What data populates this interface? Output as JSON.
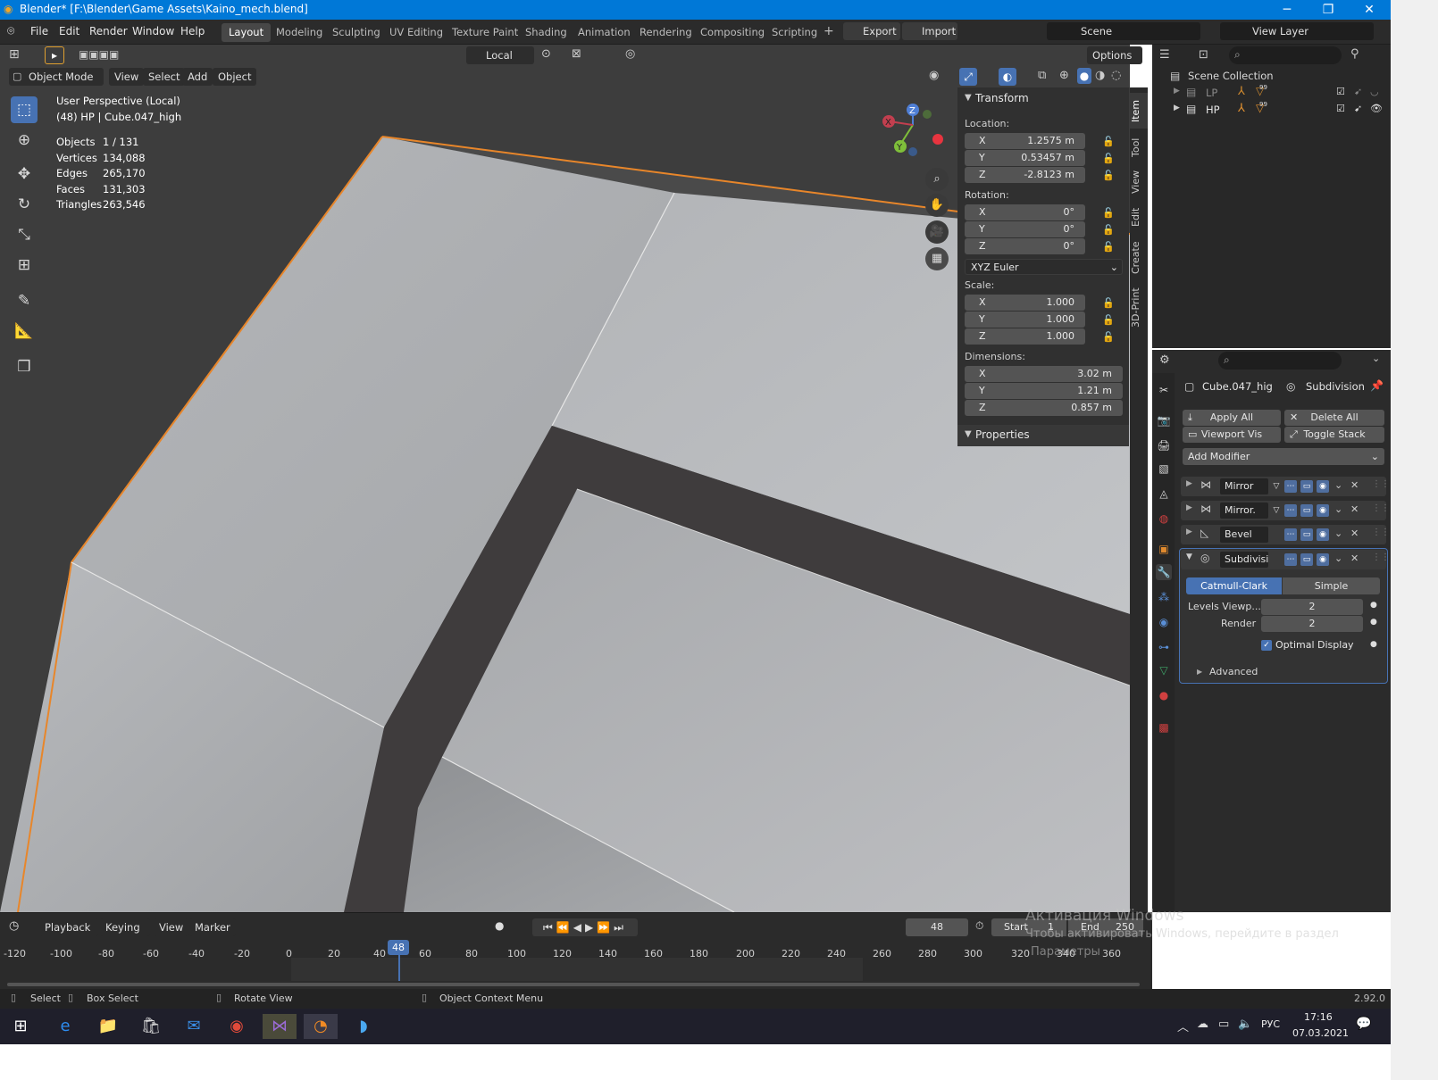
{
  "window": {
    "title": "Blender* [F:\\Blender\\Game Assets\\Kaino_mech.blend]",
    "minimize": "─",
    "maximize": "❐",
    "close": "✕"
  },
  "menu": [
    "File",
    "Edit",
    "Render",
    "Window",
    "Help"
  ],
  "workspaces": [
    "Layout",
    "Modeling",
    "Sculpting",
    "UV Editing",
    "Texture Paint",
    "Shading",
    "Animation",
    "Rendering",
    "Compositing",
    "Scripting"
  ],
  "addons": {
    "export": "Export",
    "import": "Import"
  },
  "scene": "Scene",
  "view_layer": "View Layer",
  "viewport_header": {
    "mode": "Object Mode",
    "view": "View",
    "select": "Select",
    "add": "Add",
    "object": "Object",
    "pivot": "Local",
    "options": "Options"
  },
  "overlay": {
    "perspective": "User Perspective (Local)",
    "object": "(48) HP | Cube.047_high",
    "stats": [
      {
        "label": "Objects",
        "value": "1 / 131"
      },
      {
        "label": "Vertices",
        "value": "134,088"
      },
      {
        "label": "Edges",
        "value": "265,170"
      },
      {
        "label": "Faces",
        "value": "131,303"
      },
      {
        "label": "Triangles",
        "value": "263,546"
      }
    ]
  },
  "gizmo": {
    "x": "X",
    "y": "Y",
    "z": "Z"
  },
  "npanel": {
    "transform": "Transform",
    "location_label": "Location:",
    "location": [
      {
        "axis": "X",
        "value": "1.2575 m"
      },
      {
        "axis": "Y",
        "value": "0.53457 m"
      },
      {
        "axis": "Z",
        "value": "-2.8123 m"
      }
    ],
    "rotation_label": "Rotation:",
    "rotation": [
      {
        "axis": "X",
        "value": "0°"
      },
      {
        "axis": "Y",
        "value": "0°"
      },
      {
        "axis": "Z",
        "value": "0°"
      }
    ],
    "rotation_mode": "XYZ Euler",
    "scale_label": "Scale:",
    "scale": [
      {
        "axis": "X",
        "value": "1.000"
      },
      {
        "axis": "Y",
        "value": "1.000"
      },
      {
        "axis": "Z",
        "value": "1.000"
      }
    ],
    "dimensions_label": "Dimensions:",
    "dimensions": [
      {
        "axis": "X",
        "value": "3.02 m"
      },
      {
        "axis": "Y",
        "value": "1.21 m"
      },
      {
        "axis": "Z",
        "value": "0.857 m"
      }
    ],
    "properties": "Properties",
    "tabs": [
      "Item",
      "Tool",
      "View",
      "Edit",
      "Create",
      "3D-Print"
    ]
  },
  "outliner": {
    "root": "Scene Collection",
    "items": [
      {
        "name": "LP",
        "badge": "99"
      },
      {
        "name": "HP",
        "badge": "99"
      }
    ]
  },
  "properties": {
    "object_name": "Cube.047_hig",
    "modifier_name": "Subdivision",
    "apply_all": "Apply All",
    "delete_all": "Delete All",
    "viewport_vis": "Viewport Vis",
    "toggle_stack": "Toggle Stack",
    "add_modifier": "Add Modifier",
    "modifiers": [
      {
        "name": "Mirror"
      },
      {
        "name": "Mirror."
      },
      {
        "name": "Bevel"
      },
      {
        "name": "Subdivisi..."
      }
    ],
    "subdiv": {
      "catmull": "Catmull-Clark",
      "simple": "Simple",
      "levels_label": "Levels Viewp...",
      "levels_value": "2",
      "render_label": "Render",
      "render_value": "2",
      "optimal": "Optimal Display",
      "advanced": "Advanced"
    }
  },
  "timeline": {
    "playback": "Playback",
    "keying": "Keying",
    "view": "View",
    "marker": "Marker",
    "current_frame": "48",
    "start_label": "Start",
    "start": "1",
    "end_label": "End",
    "end": "250",
    "ticks": [
      "-120",
      "-100",
      "-80",
      "-60",
      "-40",
      "-20",
      "0",
      "20",
      "40",
      "48",
      "60",
      "80",
      "100",
      "120",
      "140",
      "160",
      "180",
      "200",
      "220",
      "240",
      "260",
      "280",
      "300",
      "320",
      "340",
      "360"
    ]
  },
  "watermark": {
    "line1": "Активация Windows",
    "line2": "Чтобы активировать Windows, перейдите в раздел",
    "line3": "Параметры"
  },
  "statusbar": {
    "select": "Select",
    "box_select": "Box Select",
    "rotate": "Rotate View",
    "context": "Object Context Menu",
    "version": "2.92.0"
  },
  "taskbar": {
    "lang": "РУС",
    "time": "17:16",
    "date": "07.03.2021"
  },
  "colors": {
    "accent": "#4772b3",
    "selection_outline": "#e8862a",
    "titlebar": "#0078d7"
  }
}
